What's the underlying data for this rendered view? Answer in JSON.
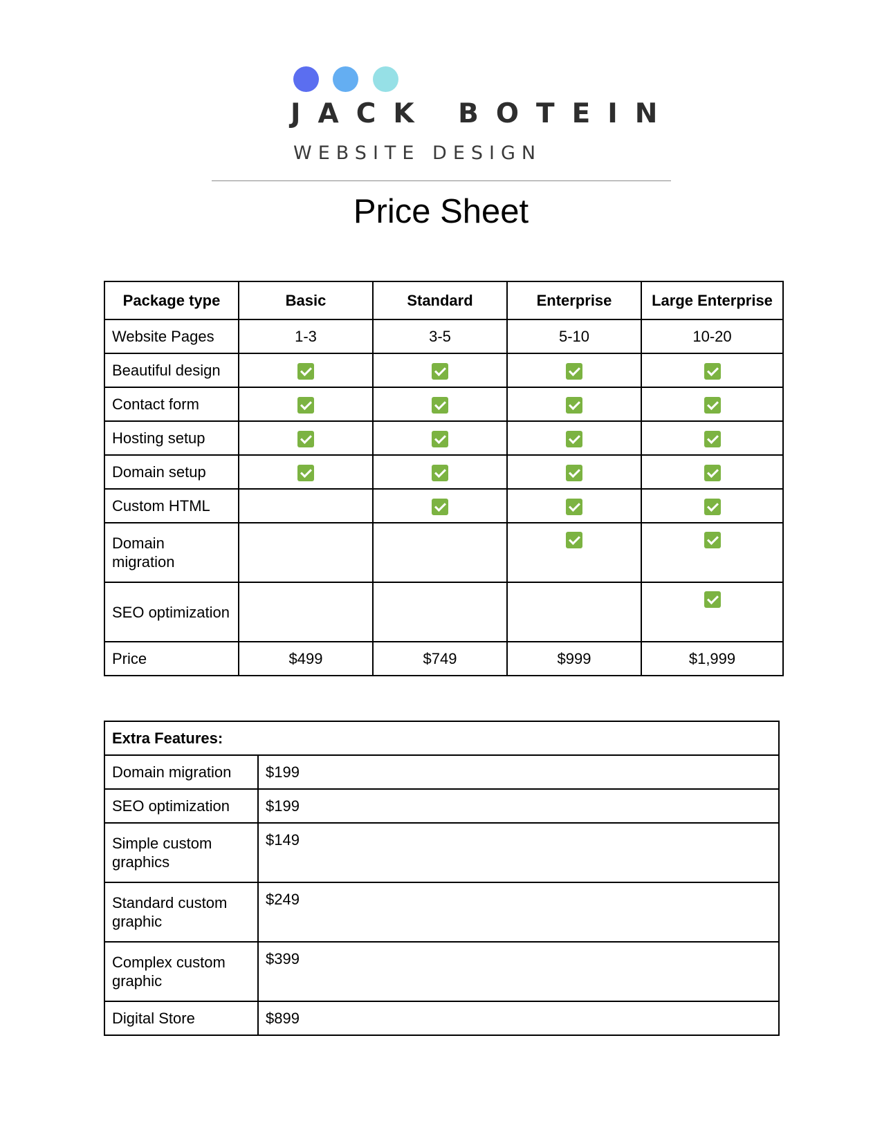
{
  "logo": {
    "name": "JACK BOTEIN",
    "subtitle": "WEBSITE DESIGN",
    "dot_colors": [
      "#5b6ef0",
      "#64aef2",
      "#96e0e6"
    ]
  },
  "title": "Price Sheet",
  "packages": {
    "headers": [
      "Package type",
      "Basic",
      "Standard",
      "Enterprise",
      "Large Enterprise"
    ],
    "website_pages": {
      "label": "Website Pages",
      "values": [
        "1-3",
        "3-5",
        "5-10",
        "10-20"
      ]
    },
    "features": [
      {
        "label": "Beautiful design",
        "included": [
          true,
          true,
          true,
          true
        ]
      },
      {
        "label": "Contact form",
        "included": [
          true,
          true,
          true,
          true
        ]
      },
      {
        "label": "Hosting setup",
        "included": [
          true,
          true,
          true,
          true
        ]
      },
      {
        "label": "Domain setup",
        "included": [
          true,
          true,
          true,
          true
        ]
      },
      {
        "label": "Custom HTML",
        "included": [
          false,
          true,
          true,
          true
        ]
      },
      {
        "label": "Domain migration",
        "included": [
          false,
          false,
          true,
          true
        ]
      },
      {
        "label": "SEO optimization",
        "included": [
          false,
          false,
          false,
          true
        ]
      }
    ],
    "price": {
      "label": "Price",
      "values": [
        "$499",
        "$749",
        "$999",
        "$1,999"
      ]
    },
    "check_icon": "green-check-icon",
    "check_color": "#7cb342"
  },
  "extras": {
    "header": "Extra Features:",
    "items": [
      {
        "name": "Domain migration",
        "price": "$199"
      },
      {
        "name": "SEO optimization",
        "price": "$199"
      },
      {
        "name": "Simple custom graphics",
        "price": "$149"
      },
      {
        "name": "Standard custom graphic",
        "price": "$249"
      },
      {
        "name": "Complex custom graphic",
        "price": "$399"
      },
      {
        "name": "Digital Store",
        "price": "$899"
      }
    ]
  }
}
